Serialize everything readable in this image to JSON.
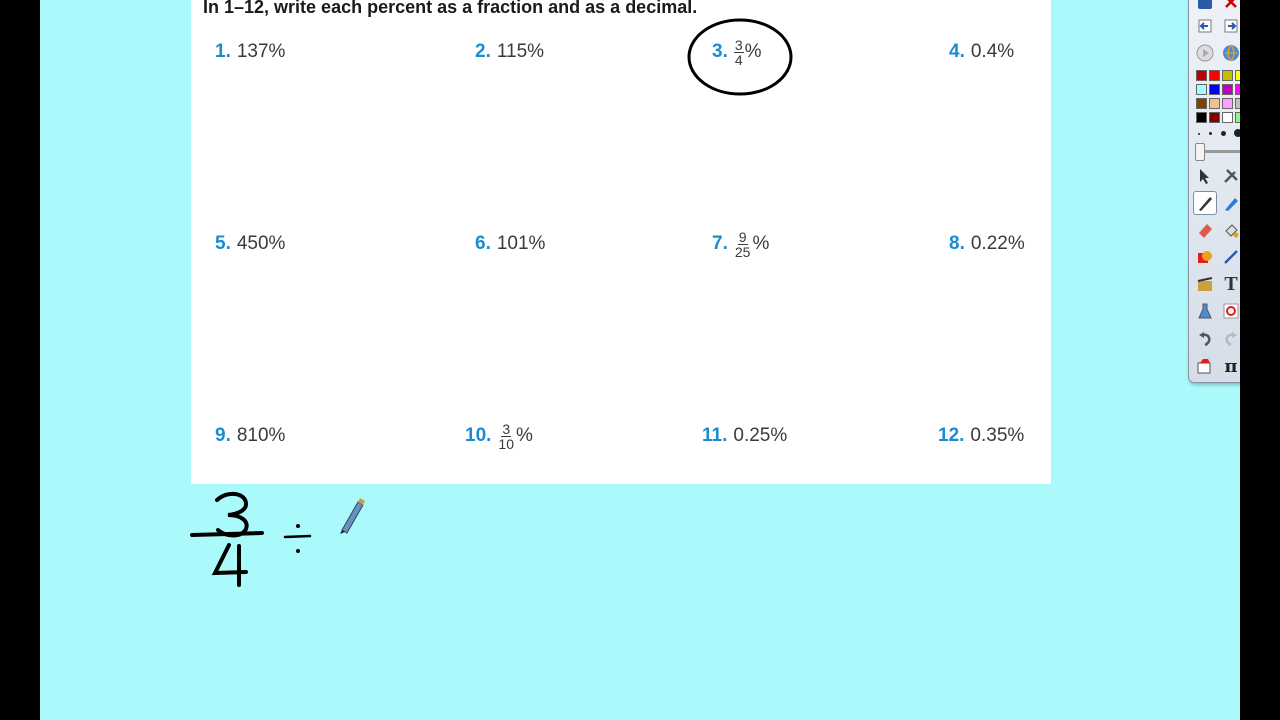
{
  "instructions": {
    "prefix": "In ",
    "range": "1–12",
    "text": ", write each percent as a fraction and as a decimal."
  },
  "problems": [
    {
      "num": "1.",
      "value": "137%"
    },
    {
      "num": "2.",
      "value": "115%"
    },
    {
      "num": "3.",
      "numerator": "3",
      "denominator": "4",
      "suffix": "%"
    },
    {
      "num": "4.",
      "value": "0.4%"
    },
    {
      "num": "5.",
      "value": "450%"
    },
    {
      "num": "6.",
      "value": "101%"
    },
    {
      "num": "7.",
      "numerator": "9",
      "denominator": "25",
      "suffix": "%"
    },
    {
      "num": "8.",
      "value": "0.22%"
    },
    {
      "num": "9.",
      "value": "810%"
    },
    {
      "num": "10.",
      "numerator": "3",
      "denominator": "10",
      "suffix": "%"
    },
    {
      "num": "11.",
      "value": "0.25%"
    },
    {
      "num": "12.",
      "value": "0.35%"
    }
  ],
  "handwriting": {
    "numerator": "3",
    "denominator": "4",
    "operator": "÷",
    "circled_problem": "3."
  },
  "colors": {
    "canvas": "#aafafc",
    "problem_number": "#1a8ccf",
    "ink": "#000000"
  },
  "toolbar": {
    "swatches": [
      "#c00000",
      "#ff0000",
      "#c0c000",
      "#ffff00",
      "#a0ffff",
      "#0000ff",
      "#c000c0",
      "#ff00ff",
      "#804000",
      "#f0c090",
      "#ffa0ff",
      "#c0c0c0",
      "#000000",
      "#800000",
      "#ffffff",
      "#80ff80"
    ],
    "tools": [
      "page-prev-icon",
      "page-next-icon",
      "play-icon",
      "web-icon",
      "screen-capture-icon",
      "select-icon",
      "tools-icon",
      "save-icon",
      "pen-icon",
      "highlighter-icon",
      "shape-recognition-icon",
      "eraser-icon",
      "fill-icon",
      "screen-shade-icon",
      "shape-icon",
      "line-icon",
      "crop-icon",
      "media-icon",
      "text-icon",
      "magnifier-icon",
      "flask-icon",
      "refresh-icon",
      "delete-icon",
      "undo-icon",
      "redo-icon",
      "handwriting-recognition-icon",
      "gallery-icon",
      "math-pi-icon",
      "clone-icon"
    ]
  }
}
